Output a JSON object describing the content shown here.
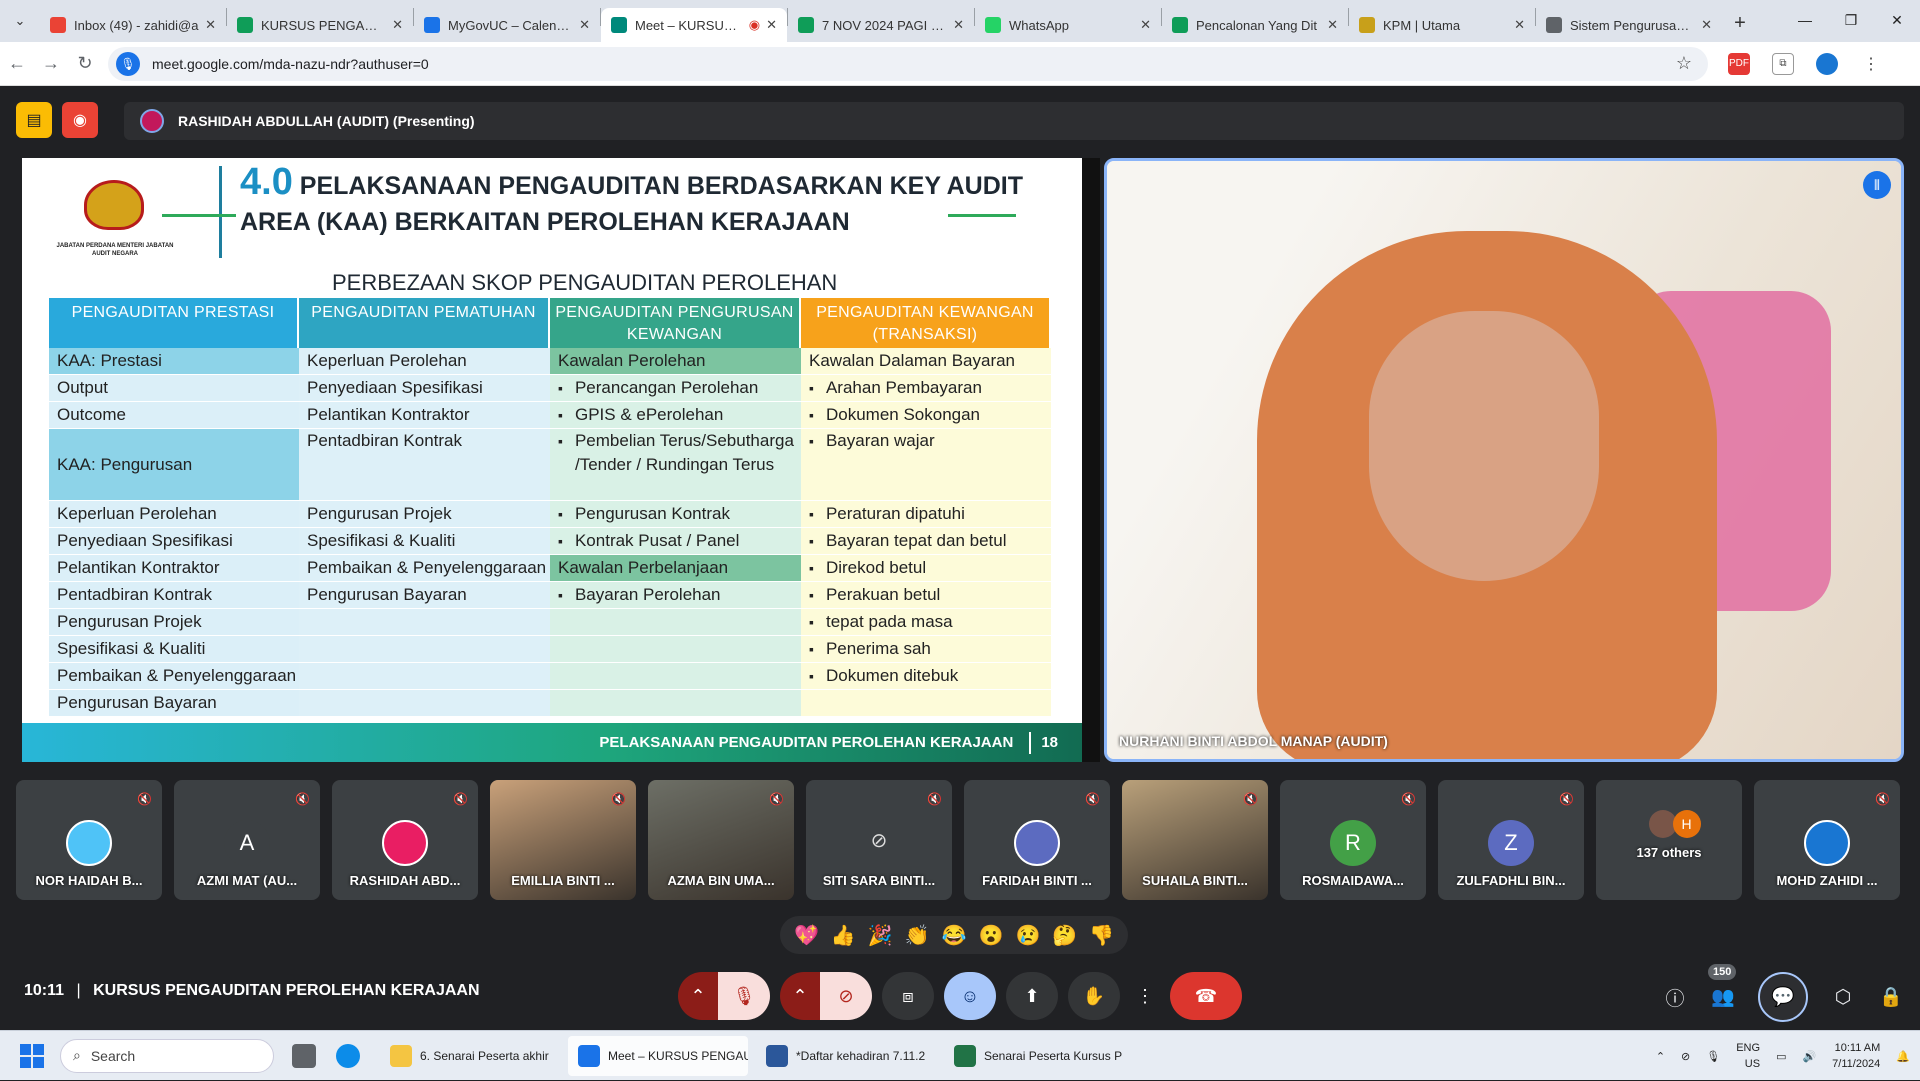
{
  "browser": {
    "tabs": [
      {
        "title": "Inbox (49) - zahidi@a",
        "color": "#ea4335"
      },
      {
        "title": "KURSUS PENGAUDITA",
        "color": "#0f9d58"
      },
      {
        "title": "MyGovUC – Calendar",
        "color": "#1a73e8"
      },
      {
        "title": "Meet – KURSUS P",
        "color": "#00897b",
        "active": true
      },
      {
        "title": "7 NOV 2024 PAGI - D",
        "color": "#0f9d58"
      },
      {
        "title": "WhatsApp",
        "color": "#25d366"
      },
      {
        "title": "Pencalonan Yang Dit",
        "color": "#0f9d58"
      },
      {
        "title": "KPM | Utama",
        "color": "#c8a01a"
      },
      {
        "title": "Sistem Pengurusan P",
        "color": "#5f6368"
      }
    ],
    "url": "meet.google.com/mda-nazu-ndr?authuser=0"
  },
  "meet": {
    "presenter": "RASHIDAH ABDULLAH (AUDIT) (Presenting)",
    "main_speaker": "NURHANI BINTI ABDOL MANAP (AUDIT)",
    "meeting_time": "10:11",
    "meeting_title": "KURSUS PENGAUDITAN PEROLEHAN KERAJAAN",
    "participant_count": "150",
    "reactions": [
      "💖",
      "👍",
      "🎉",
      "👏",
      "😂",
      "😮",
      "😢",
      "🤔",
      "👎"
    ]
  },
  "slide": {
    "logo_text": "JABATAN PERDANA MENTERI JABATAN AUDIT NEGARA",
    "title_num": "4.0",
    "title_line1": "PELAKSANAAN PENGAUDITAN BERDASARKAN KEY AUDIT",
    "title_line2": "AREA (KAA) BERKAITAN PEROLEHAN KERAJAAN",
    "subtitle": "PERBEZAAN SKOP PENGAUDITAN PEROLEHAN",
    "footer": "PELAKSANAAN PENGAUDITAN PEROLEHAN KERAJAAN",
    "page": "18",
    "columns": [
      {
        "header": "PENGAUDITAN PRESTASI",
        "bg": "#dbeff8",
        "hbg": "#29a9dc",
        "rows": [
          {
            "t": "KAA: Prestasi",
            "hb": true
          },
          {
            "t": "Output"
          },
          {
            "t": "Outcome"
          },
          {
            "t": "KAA: Pengurusan",
            "hb": true,
            "tall": true
          },
          {
            "t": "Keperluan Perolehan"
          },
          {
            "t": "Penyediaan Spesifikasi"
          },
          {
            "t": "Pelantikan Kontraktor"
          },
          {
            "t": "Pentadbiran Kontrak"
          },
          {
            "t": "Pengurusan Projek"
          },
          {
            "t": "Spesifikasi & Kualiti"
          },
          {
            "t": "Pembaikan & Penyelenggaraan"
          },
          {
            "t": "Pengurusan Bayaran"
          }
        ]
      },
      {
        "header": "PENGAUDITAN PEMATUHAN",
        "bg": "#ddf0f8",
        "hbg": "#2ea5c2",
        "rows": [
          {
            "t": "Keperluan Perolehan"
          },
          {
            "t": "Penyediaan Spesifikasi"
          },
          {
            "t": "Pelantikan Kontraktor"
          },
          {
            "t": "Pentadbiran Kontrak",
            "tall": true
          },
          {
            "t": "Pengurusan Projek"
          },
          {
            "t": "Spesifikasi & Kualiti"
          },
          {
            "t": "Pembaikan & Penyelenggaraan"
          },
          {
            "t": "Pengurusan Bayaran"
          },
          {
            "t": ""
          },
          {
            "t": ""
          },
          {
            "t": ""
          },
          {
            "t": ""
          }
        ]
      },
      {
        "header": "PENGAUDITAN PENGURUSAN KEWANGAN",
        "bg": "#d9f1e6",
        "hbg": "#35a58a",
        "rows": [
          {
            "t": "Kawalan Perolehan",
            "hl": true
          },
          {
            "t": "Perancangan Perolehan",
            "b": true
          },
          {
            "t": "GPIS & ePerolehan",
            "b": true
          },
          {
            "t": "Pembelian Terus/Sebutharga /Tender / Rundingan Terus",
            "b": true,
            "tall": true
          },
          {
            "t": "Pengurusan Kontrak",
            "b": true
          },
          {
            "t": "Kontrak Pusat / Panel",
            "b": true
          },
          {
            "t": "Kawalan Perbelanjaan",
            "hl": true
          },
          {
            "t": "Bayaran Perolehan",
            "b": true
          },
          {
            "t": ""
          },
          {
            "t": ""
          },
          {
            "t": ""
          },
          {
            "t": ""
          }
        ]
      },
      {
        "header": "PENGAUDITAN KEWANGAN (TRANSAKSI)",
        "bg": "#fdfbd9",
        "hbg": "#f7a21b",
        "rows": [
          {
            "t": "Kawalan Dalaman Bayaran"
          },
          {
            "t": "Arahan Pembayaran",
            "b": true
          },
          {
            "t": "Dokumen Sokongan",
            "b": true
          },
          {
            "t": "Bayaran wajar",
            "b": true,
            "tall": true
          },
          {
            "t": "Peraturan dipatuhi",
            "b": true
          },
          {
            "t": "Bayaran tepat dan betul",
            "b": true
          },
          {
            "t": "Direkod betul",
            "b": true
          },
          {
            "t": "Perakuan betul",
            "b": true
          },
          {
            "t": "tepat pada masa",
            "b": true
          },
          {
            "t": "Penerima sah",
            "b": true
          },
          {
            "t": "Dokumen ditebuk",
            "b": true
          },
          {
            "t": ""
          }
        ]
      }
    ]
  },
  "participants": [
    {
      "name": "NOR HAIDAH B...",
      "kind": "avatar",
      "color": "#4fc3f7",
      "initial": ""
    },
    {
      "name": "AZMI MAT (AU...",
      "kind": "letter",
      "color": "#3c4043",
      "initial": "A"
    },
    {
      "name": "RASHIDAH ABD...",
      "kind": "avatar",
      "color": "#e91e63",
      "initial": ""
    },
    {
      "name": "EMILLIA BINTI ...",
      "kind": "video",
      "color": "#c9a17a",
      "initial": ""
    },
    {
      "name": "AZMA BIN UMA...",
      "kind": "video",
      "color": "#6d6f66",
      "initial": ""
    },
    {
      "name": "SITI SARA BINTI...",
      "kind": "nocam",
      "color": "#3c4043",
      "initial": ""
    },
    {
      "name": "FARIDAH BINTI ...",
      "kind": "avatar",
      "color": "#5c6bc0",
      "initial": ""
    },
    {
      "name": "SUHAILA BINTI...",
      "kind": "video",
      "color": "#b9a07a",
      "initial": ""
    },
    {
      "name": "ROSMAIDAWA...",
      "kind": "letter",
      "color": "#43a047",
      "initial": "R"
    },
    {
      "name": "ZULFADHLI BIN...",
      "kind": "letter",
      "color": "#5c6bc0",
      "initial": "Z"
    },
    {
      "name": "137 others",
      "kind": "others",
      "color": "#e8710a",
      "initial": "H"
    },
    {
      "name": "MOHD ZAHIDI ...",
      "kind": "avatar",
      "color": "#1976d2",
      "initial": ""
    }
  ],
  "taskbar": {
    "search": "Search",
    "apps": [
      {
        "label": "6. Senarai Peserta akhir",
        "color": "#f4c542"
      },
      {
        "label": "Meet – KURSUS PENGAU",
        "color": "#1a73e8",
        "active": true
      },
      {
        "label": "*Daftar kehadiran 7.11.2",
        "color": "#2b579a"
      },
      {
        "label": "Senarai Peserta Kursus P",
        "color": "#217346"
      }
    ],
    "lang1": "ENG",
    "lang2": "US",
    "time": "10:11 AM",
    "date": "7/11/2024"
  }
}
